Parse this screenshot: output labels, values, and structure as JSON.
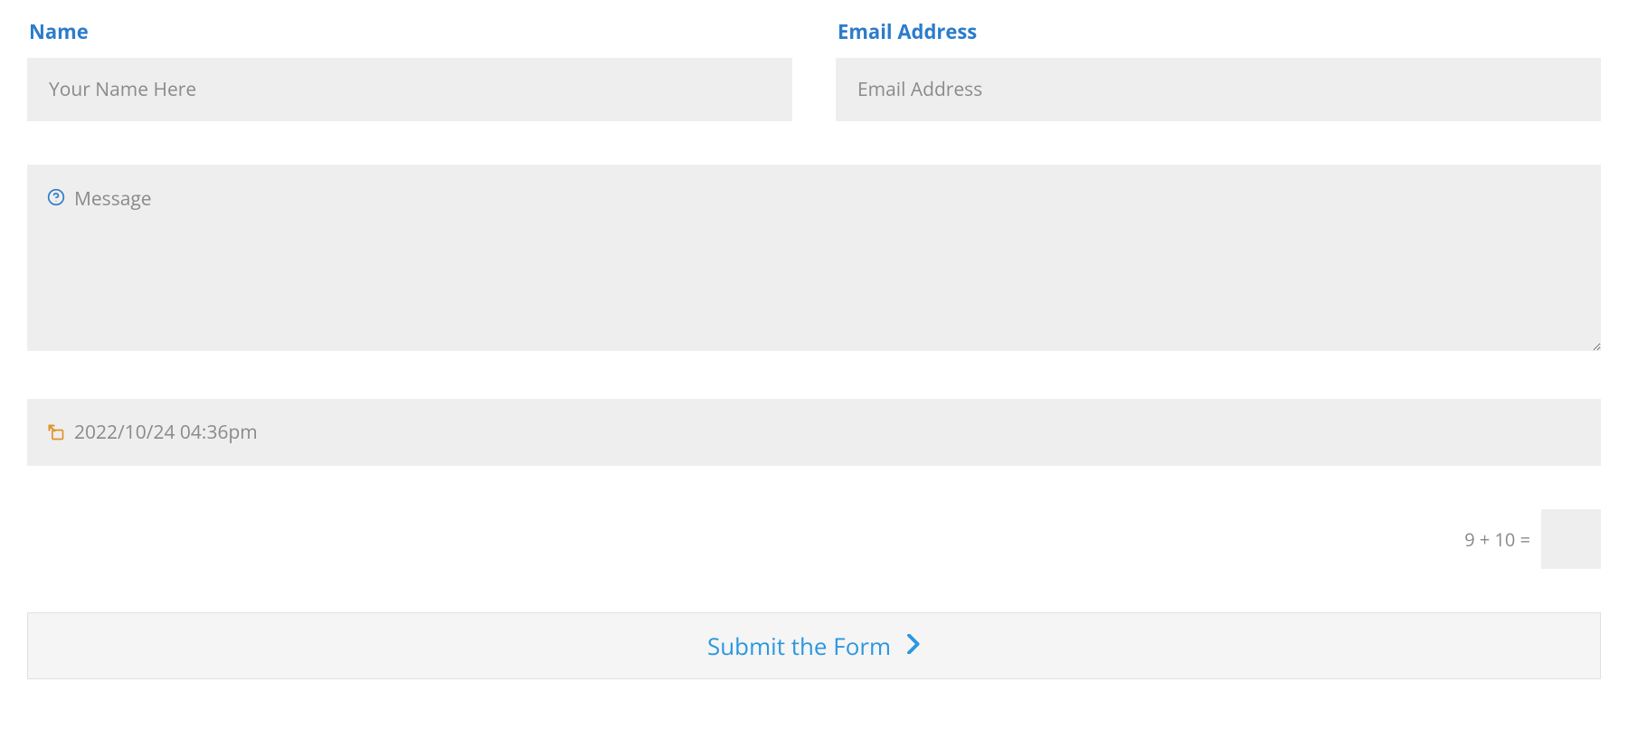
{
  "form": {
    "name": {
      "label": "Name",
      "placeholder": "Your Name Here"
    },
    "email": {
      "label": "Email Address",
      "placeholder": "Email Address"
    },
    "message": {
      "placeholder": "Message"
    },
    "datetime": {
      "value": "2022/10/24 04:36pm"
    },
    "captcha": {
      "question": "9 + 10 ="
    },
    "submit": {
      "label": "Submit the Form"
    }
  }
}
